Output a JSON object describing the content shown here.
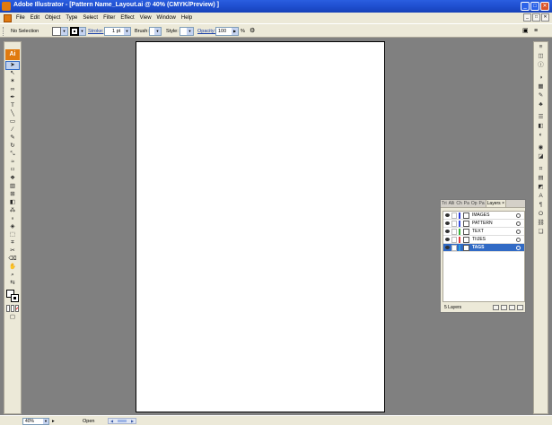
{
  "window": {
    "title": "Adobe Illustrator - [Pattern Name_Layout.ai @ 40% (CMYK/Preview) ]",
    "min_glyph": "_",
    "max_glyph": "□",
    "close_glyph": "✕"
  },
  "menu": [
    "File",
    "Edit",
    "Object",
    "Type",
    "Select",
    "Filter",
    "Effect",
    "View",
    "Window",
    "Help"
  ],
  "control_bar": {
    "selection": "No Selection",
    "stroke_label": "Stroke:",
    "stroke_value": "1 pt",
    "brush_label": "Brush:",
    "style_label": "Style:",
    "opacity_label": "Opacity:",
    "opacity_value": "100",
    "percent": "%"
  },
  "toolbox": {
    "logo": "Ai"
  },
  "layers_panel": {
    "tabs": [
      "Tri",
      "Alli",
      "Ch",
      "Pa",
      "Op",
      "Pa",
      "Layers"
    ],
    "tab_close": "×",
    "layers": [
      {
        "name": "IMAGES",
        "color": "#2e3fdc",
        "selected": false
      },
      {
        "name": "PATTERN",
        "color": "#3b4fe0",
        "selected": false
      },
      {
        "name": "TEXT",
        "color": "#3cb43c",
        "selected": false
      },
      {
        "name": "TIIJES",
        "color": "#e03c3c",
        "selected": false
      },
      {
        "name": "TAGS",
        "color": "#2fa0e0",
        "selected": true
      }
    ],
    "count": "5 Layers"
  },
  "status_bar": {
    "zoom": "40%",
    "status": "Open"
  }
}
